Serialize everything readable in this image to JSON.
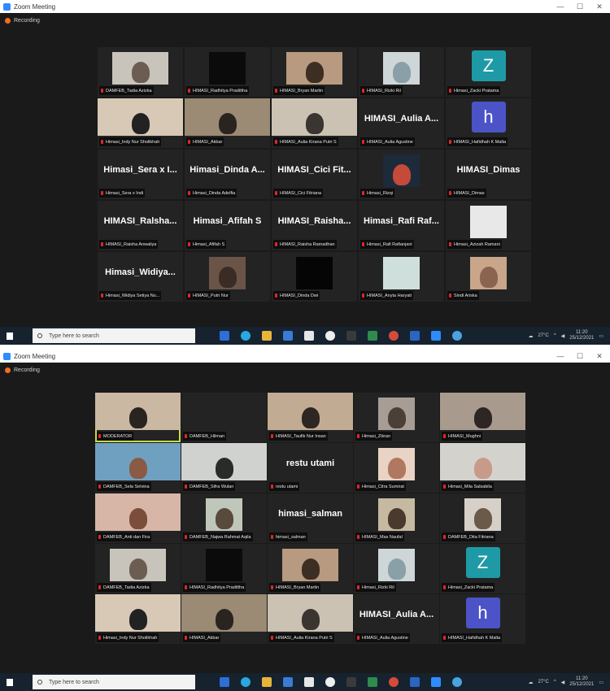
{
  "window": {
    "title": "Zoom Meeting",
    "minimize": "—",
    "maximize": "☐",
    "close": "✕"
  },
  "recording_label": "Recording",
  "taskbar": {
    "search_placeholder": "Type here to search",
    "temperature": "27°C",
    "top_time": "11:20",
    "top_date": "25/12/2021",
    "bottom_time": "11:20",
    "bottom_date": "25/12/2021"
  },
  "top_tiles": [
    {
      "kind": "video",
      "label": "DAMFEB_Tadia Azizka",
      "bg": "#c9c4bb",
      "face": "#6b5d52",
      "layout": "inset"
    },
    {
      "kind": "video",
      "label": "HIMASI_Radhitya Pradittha",
      "bg": "#0b0b0b",
      "face": "#0b0b0b",
      "layout": "small"
    },
    {
      "kind": "video",
      "label": "HIMASI_Bryan Martin",
      "bg": "#b79a7f",
      "face": "#3d2e24",
      "layout": "inset"
    },
    {
      "kind": "video",
      "label": "HIMASI_Rizki Ril",
      "bg": "#cfd6d8",
      "face": "#8aa0a8",
      "layout": "small"
    },
    {
      "kind": "avatar",
      "label": "Himasi_Zacki Pratama",
      "letter": "Z",
      "color": "#1e9aa6"
    },
    {
      "kind": "video",
      "label": "Himasi_Indy Nur Sholikhah",
      "bg": "#d8c9b6",
      "face": "#222222",
      "layout": "full"
    },
    {
      "kind": "video",
      "label": "HIMASI_Akbar",
      "bg": "#9b8a74",
      "face": "#2a2420",
      "layout": "full"
    },
    {
      "kind": "video",
      "label": "HIMASI_Aulia Kirana Putri S",
      "bg": "#cbc2b4",
      "face": "#3a3530",
      "layout": "full"
    },
    {
      "kind": "name",
      "name": "HIMASI_Aulia A...",
      "label": "HIMASI_Aulia Agustine"
    },
    {
      "kind": "avatar",
      "label": "HIMASI_Hafidhah K Malta",
      "letter": "h",
      "color": "#4b53c6"
    },
    {
      "kind": "name",
      "name": "Himasi_Sera x I...",
      "label": "Himasi_Sera x Indi"
    },
    {
      "kind": "name",
      "name": "Himasi_Dinda A...",
      "label": "Himasi_Dinda Adelfia"
    },
    {
      "kind": "name",
      "name": "HIMASI_Cici Fit...",
      "label": "HIMASI_Cici Fitriana"
    },
    {
      "kind": "video",
      "label": "Himasi_Rizqi",
      "bg": "#1d2a3a",
      "face": "#c54a3a",
      "layout": "small"
    },
    {
      "kind": "name",
      "name": "HIMASI_Dimas",
      "label": "HIMASI_Dimas"
    },
    {
      "kind": "name",
      "name": "HIMASI_Ralsha...",
      "label": "HIMASI_Raisha Anwaliya"
    },
    {
      "kind": "name",
      "name": "Himasi_Afifah S",
      "label": "Himasi_Afifah S"
    },
    {
      "kind": "name",
      "name": "HIMASI_Raisha...",
      "label": "HIMASI_Raisha Ramadhan"
    },
    {
      "kind": "name",
      "name": "Himasi_Rafi Raf...",
      "label": "Himasi_Rafi Rafianjani"
    },
    {
      "kind": "video",
      "label": "Himasi_Azizah Ramani",
      "bg": "#e8e8e8",
      "face": "#e8e8e8",
      "layout": "small"
    },
    {
      "kind": "name",
      "name": "Himasi_Widiya...",
      "label": "Himasi_Widiya Setiya Nu..."
    },
    {
      "kind": "video",
      "label": "HIMASI_Putri Nur",
      "bg": "#6a5448",
      "face": "#3a2c24",
      "layout": "small"
    },
    {
      "kind": "video",
      "label": "HIMASI_Dinda Dwi",
      "bg": "#050505",
      "face": "#050505",
      "layout": "small"
    },
    {
      "kind": "video",
      "label": "HIMASI_Anyta Haryati",
      "bg": "#cfe0dc",
      "face": "#cfe0dc",
      "layout": "small"
    },
    {
      "kind": "video",
      "label": "Sindi Ariska",
      "bg": "#c9a58a",
      "face": "#8a6450",
      "layout": "small"
    }
  ],
  "bottom_tiles": [
    {
      "kind": "video",
      "label": "MODERATOR",
      "bg": "#cbb8a2",
      "face": "#2a2420",
      "layout": "full",
      "active": true
    },
    {
      "kind": "empty",
      "label": "DAMFEB_Hilman"
    },
    {
      "kind": "video",
      "label": "HIMASI_Taufik Nur Insan",
      "bg": "#c1ab92",
      "face": "#2e2622",
      "layout": "full"
    },
    {
      "kind": "video",
      "label": "Himasi_Zikran",
      "bg": "#a89d94",
      "face": "#4a4038",
      "layout": "small"
    },
    {
      "kind": "video",
      "label": "HIMASI_Mughni",
      "bg": "#a99a8e",
      "face": "#2e2622",
      "layout": "full"
    },
    {
      "kind": "video",
      "label": "DAMFEB_Sela Selvina",
      "bg": "#6fa0c0",
      "face": "#8a5a44",
      "layout": "full"
    },
    {
      "kind": "video",
      "label": "DAMFEB_Sifra Wulan",
      "bg": "#cfd2cf",
      "face": "#2a2a2a",
      "layout": "full"
    },
    {
      "kind": "name",
      "name": "restu utami",
      "label": "restu utami"
    },
    {
      "kind": "video",
      "label": "Himasi_Citra Sumirat",
      "bg": "#e9d3c4",
      "face": "#b07860",
      "layout": "small"
    },
    {
      "kind": "video",
      "label": "Himasi_Mila Salsabila",
      "bg": "#d4d2cc",
      "face": "#c79a8a",
      "layout": "full"
    },
    {
      "kind": "video",
      "label": "DAMFEB_Anti dan Fira",
      "bg": "#d7b6a8",
      "face": "#7a4e3a",
      "layout": "full"
    },
    {
      "kind": "video",
      "label": "DAMFEB_Najwa Rahmat Aqila",
      "bg": "#bfc7bb",
      "face": "#5a4a3c",
      "layout": "small"
    },
    {
      "kind": "name",
      "name": "himasi_salman",
      "label": "himasi_salman"
    },
    {
      "kind": "video",
      "label": "HIMASI_Mas Naufal",
      "bg": "#c6b9a1",
      "face": "#4a3a2e",
      "layout": "small"
    },
    {
      "kind": "video",
      "label": "DAMFEB_Dita Fitriana",
      "bg": "#d6d0c8",
      "face": "#6a5a4a",
      "layout": "small"
    },
    {
      "kind": "video",
      "label": "DAMFEB_Tadia Azizka",
      "bg": "#c9c4bb",
      "face": "#6b5d52",
      "layout": "inset"
    },
    {
      "kind": "video",
      "label": "HIMASI_Radhitya Pradittha",
      "bg": "#0b0b0b",
      "face": "#0b0b0b",
      "layout": "small"
    },
    {
      "kind": "video",
      "label": "HIMASI_Bryan Martin",
      "bg": "#b79a7f",
      "face": "#3d2e24",
      "layout": "inset"
    },
    {
      "kind": "video",
      "label": "Himasi_Rizki Ril",
      "bg": "#cfd6d8",
      "face": "#8aa0a8",
      "layout": "small"
    },
    {
      "kind": "avatar",
      "label": "Himasi_Zacki Pratama",
      "letter": "Z",
      "color": "#1e9aa6"
    },
    {
      "kind": "video",
      "label": "Himasi_Indy Nur Sholikhah",
      "bg": "#d8c9b6",
      "face": "#222222",
      "layout": "full"
    },
    {
      "kind": "video",
      "label": "HIMASI_Akbar",
      "bg": "#9b8a74",
      "face": "#2a2420",
      "layout": "full"
    },
    {
      "kind": "video",
      "label": "HIMASI_Aulia Kirana Putri S",
      "bg": "#cbc2b4",
      "face": "#3a3530",
      "layout": "full"
    },
    {
      "kind": "name",
      "name": "HIMASI_Aulia A...",
      "label": "HIMASI_Aulia Agustine"
    },
    {
      "kind": "avatar",
      "label": "HIMASI_Hafidhah K Malta",
      "letter": "h",
      "color": "#4b53c6"
    }
  ]
}
